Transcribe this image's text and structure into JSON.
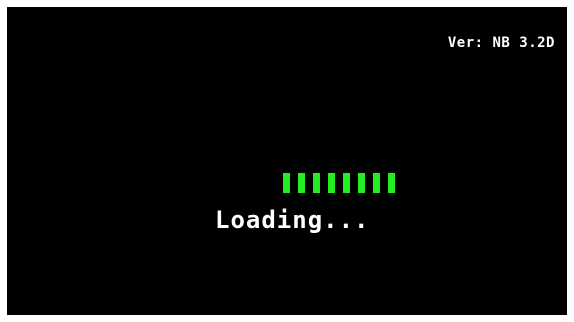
{
  "version": {
    "text": "Ver: NB 3.2D"
  },
  "loading": {
    "text": "Loading...",
    "progress_segments_filled": 8,
    "segment_color": "#22ee22"
  },
  "colors": {
    "background": "#000000",
    "text": "#ffffff"
  }
}
